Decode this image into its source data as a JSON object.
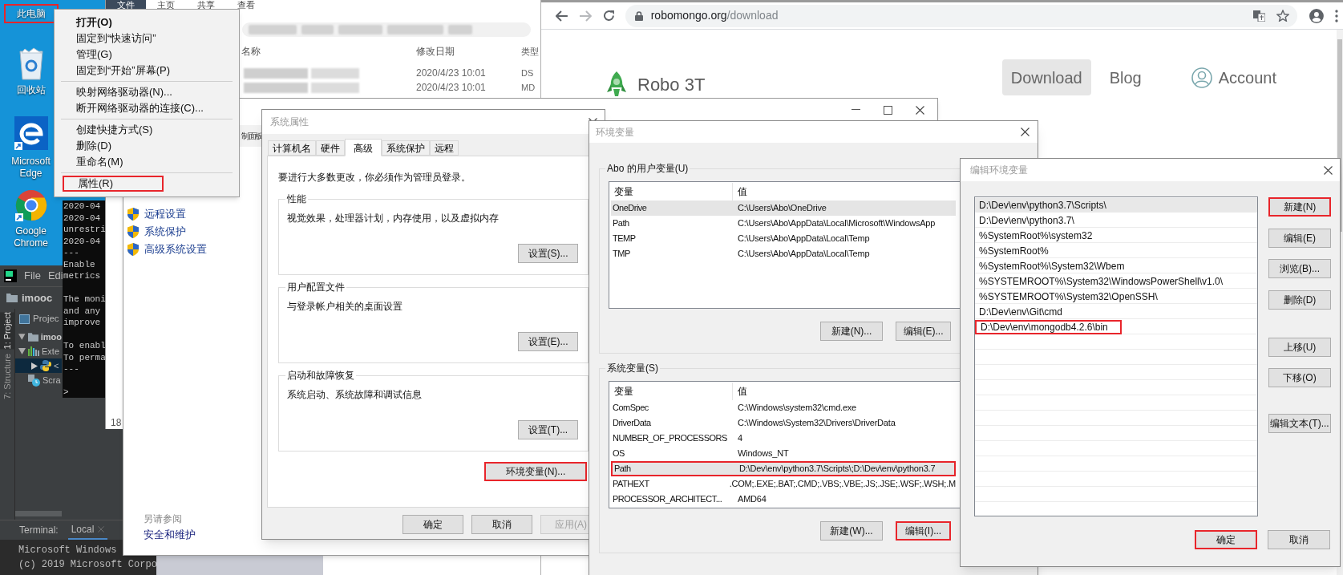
{
  "desktop_icons": [
    {
      "kind": "computer",
      "label": "此电脑",
      "highlighted": true
    },
    {
      "kind": "recycle_bin",
      "label": "回收站",
      "highlighted": false
    },
    {
      "kind": "edge",
      "label": "Microsoft Edge",
      "highlighted": false
    },
    {
      "kind": "chrome",
      "label": "Google Chrome",
      "highlighted": false
    }
  ],
  "context_menu": {
    "groups": [
      [
        {
          "label": "打开(O)",
          "default": true,
          "highlighted": false
        },
        {
          "label": "固定到“快速访问”",
          "default": false,
          "highlighted": false
        },
        {
          "label": "管理(G)",
          "default": false,
          "highlighted": false
        },
        {
          "label": "固定到“开始”屏幕(P)",
          "default": false,
          "highlighted": false
        }
      ],
      [
        {
          "label": "映射网络驱动器(N)...",
          "default": false,
          "highlighted": false
        },
        {
          "label": "断开网络驱动器的连接(C)...",
          "default": false,
          "highlighted": false
        }
      ],
      [
        {
          "label": "创建快捷方式(S)",
          "default": false,
          "highlighted": false
        },
        {
          "label": "删除(D)",
          "default": false,
          "highlighted": false
        },
        {
          "label": "重命名(M)",
          "default": false,
          "highlighted": false
        }
      ],
      [
        {
          "label": "属性(R)",
          "default": false,
          "highlighted": true
        }
      ]
    ]
  },
  "console": {
    "blocks": [
      [
        "2020-04",
        "2020-04",
        "unrestri",
        "2020-04",
        "---",
        "Enable",
        "metrics"
      ],
      [
        "The moni",
        "and any",
        "improve"
      ],
      [
        "To enabl",
        "To perma",
        "---"
      ],
      [
        ">"
      ]
    ]
  },
  "pycharm": {
    "menu": [
      "File",
      "Edi"
    ],
    "breadcrumb": "imooc",
    "tool_windows": [
      {
        "label": "1: Project",
        "selected": true
      },
      {
        "label": "7: Structure",
        "selected": false
      }
    ],
    "project_title": "Projec",
    "tree": [
      {
        "kind": "folder",
        "label": "imoo",
        "expanded": true,
        "selected": false
      },
      {
        "kind": "libraries",
        "label": "Exte",
        "expanded": true,
        "selected": false,
        "children": [
          {
            "kind": "python",
            "label": "<",
            "expanded": false,
            "selected": true
          }
        ]
      },
      {
        "kind": "scratches",
        "label": "Scra",
        "selected": false
      }
    ],
    "terminal": {
      "title": "Terminal:",
      "tab": "Local",
      "lines": [
        "Microsoft Windows",
        "(c) 2019 Microsoft Corpo"
      ]
    }
  },
  "explorer": {
    "ribbon_tabs": [
      {
        "label": "文件",
        "selected": true
      },
      {
        "label": "主页",
        "selected": false
      },
      {
        "label": "共享",
        "selected": false
      },
      {
        "label": "查看",
        "selected": false
      }
    ],
    "columns": [
      "名称",
      "修改日期",
      "类型"
    ],
    "rows": [
      {
        "modified": "2020/4/23 10:01",
        "type": "DS"
      },
      {
        "modified": "2020/4/23 10:01",
        "type": "MD"
      }
    ],
    "status": "18"
  },
  "control_panel": {
    "address": "制面板",
    "tasks": [
      "远程设置",
      "系统保护",
      "高级系统设置"
    ],
    "see_also_title": "另请参阅",
    "see_also": [
      "安全和维护"
    ]
  },
  "browser": {
    "url_host": "robomongo.org",
    "url_path": "/download",
    "site_name": "Robo 3T",
    "nav": [
      {
        "kind": "link",
        "label": "Download",
        "selected": true
      },
      {
        "kind": "link",
        "label": "Blog",
        "selected": false
      },
      {
        "kind": "account",
        "label": "Account",
        "selected": false
      }
    ]
  },
  "system_properties": {
    "title": "系统属性",
    "tabs": [
      {
        "label": "计算机名",
        "selected": false
      },
      {
        "label": "硬件",
        "selected": false
      },
      {
        "label": "高级",
        "selected": true
      },
      {
        "label": "系统保护",
        "selected": false
      },
      {
        "label": "远程",
        "selected": false
      }
    ],
    "notice": "要进行大多数更改，你必须作为管理员登录。",
    "groups": [
      {
        "title": "性能",
        "description": "视觉效果，处理器计划，内存使用，以及虚拟内存",
        "button": "设置(S)..."
      },
      {
        "title": "用户配置文件",
        "description": "与登录帐户相关的桌面设置",
        "button": "设置(E)..."
      },
      {
        "title": "启动和故障恢复",
        "description": "系统启动、系统故障和调试信息",
        "button": "设置(T)..."
      }
    ],
    "env_button": {
      "label": "环境变量(N)...",
      "highlighted": true
    },
    "buttons": [
      {
        "label": "确定",
        "disabled": false
      },
      {
        "label": "取消",
        "disabled": false
      },
      {
        "label": "应用(A)",
        "disabled": true
      }
    ]
  },
  "environment_variables": {
    "title": "环境变量",
    "user_section": {
      "title": "Abo 的用户变量(U)",
      "columns": [
        "变量",
        "值"
      ],
      "rows": [
        {
          "name": "OneDrive",
          "value": "C:\\Users\\Abo\\OneDrive",
          "selected": true,
          "highlighted": false
        },
        {
          "name": "Path",
          "value": "C:\\Users\\Abo\\AppData\\Local\\Microsoft\\WindowsApp",
          "selected": false,
          "highlighted": false
        },
        {
          "name": "TEMP",
          "value": "C:\\Users\\Abo\\AppData\\Local\\Temp",
          "selected": false,
          "highlighted": false
        },
        {
          "name": "TMP",
          "value": "C:\\Users\\Abo\\AppData\\Local\\Temp",
          "selected": false,
          "highlighted": false
        }
      ],
      "buttons": [
        {
          "label": "新建(N)...",
          "highlighted": false
        },
        {
          "label": "编辑(E)...",
          "highlighted": false
        }
      ]
    },
    "system_section": {
      "title": "系统变量(S)",
      "columns": [
        "变量",
        "值"
      ],
      "rows": [
        {
          "name": "ComSpec",
          "value": "C:\\Windows\\system32\\cmd.exe",
          "selected": false,
          "highlighted": false
        },
        {
          "name": "DriverData",
          "value": "C:\\Windows\\System32\\Drivers\\DriverData",
          "selected": false,
          "highlighted": false
        },
        {
          "name": "NUMBER_OF_PROCESSORS",
          "value": "4",
          "selected": false,
          "highlighted": false
        },
        {
          "name": "OS",
          "value": "Windows_NT",
          "selected": false,
          "highlighted": false
        },
        {
          "name": "Path",
          "value": "D:\\Dev\\env\\python3.7\\Scripts\\;D:\\Dev\\env\\python3.7",
          "selected": true,
          "highlighted": true
        },
        {
          "name": "PATHEXT",
          "value": ".COM;.EXE;.BAT;.CMD;.VBS;.VBE;.JS;.JSE;.WSF;.WSH;.M",
          "selected": false,
          "highlighted": false
        },
        {
          "name": "PROCESSOR_ARCHITECT...",
          "value": "AMD64",
          "selected": false,
          "highlighted": false
        }
      ],
      "buttons": [
        {
          "label": "新建(W)...",
          "highlighted": false
        },
        {
          "label": "编辑(I)...",
          "highlighted": true
        }
      ]
    }
  },
  "edit_environment_variable": {
    "title": "编辑环境变量",
    "entries": [
      {
        "text": "D:\\Dev\\env\\python3.7\\Scripts\\",
        "selected": true,
        "highlighted": false
      },
      {
        "text": "D:\\Dev\\env\\python3.7\\",
        "selected": false,
        "highlighted": false
      },
      {
        "text": "%SystemRoot%\\system32",
        "selected": false,
        "highlighted": false
      },
      {
        "text": "%SystemRoot%",
        "selected": false,
        "highlighted": false
      },
      {
        "text": "%SystemRoot%\\System32\\Wbem",
        "selected": false,
        "highlighted": false
      },
      {
        "text": "%SYSTEMROOT%\\System32\\WindowsPowerShell\\v1.0\\",
        "selected": false,
        "highlighted": false
      },
      {
        "text": "%SYSTEMROOT%\\System32\\OpenSSH\\",
        "selected": false,
        "highlighted": false
      },
      {
        "text": "D:\\Dev\\env\\Git\\cmd",
        "selected": false,
        "highlighted": false
      },
      {
        "text": "D:\\Dev\\env\\mongodb4.2.6\\bin",
        "selected": false,
        "highlighted": true
      }
    ],
    "buttons": [
      {
        "label": "新建(N)",
        "highlighted": true
      },
      {
        "label": "编辑(E)",
        "highlighted": false
      },
      {
        "label": "浏览(B)...",
        "highlighted": false
      },
      {
        "label": "删除(D)",
        "highlighted": false
      },
      {
        "label": "上移(U)",
        "highlighted": false
      },
      {
        "label": "下移(O)",
        "highlighted": false
      },
      {
        "label": "编辑文本(T)...",
        "highlighted": false
      }
    ],
    "footer_buttons": [
      {
        "label": "确定",
        "highlighted": true
      },
      {
        "label": "取消",
        "highlighted": false
      }
    ]
  }
}
